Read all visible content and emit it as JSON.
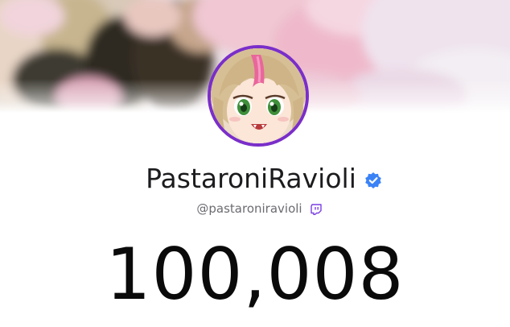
{
  "profile": {
    "display_name": "PastaroniRavioli",
    "handle": "@pastaroniravioli",
    "verified": true,
    "platform_icon": "twitch-icon"
  },
  "stats": {
    "follower_count": "100,008"
  },
  "colors": {
    "avatar_ring": "#7a2ec9",
    "verified_badge": "#3b82f6",
    "twitch_purple": "#7b3fe4",
    "text_primary": "#1c1c1f",
    "text_secondary": "#6b6b72"
  },
  "icons": {
    "verified": "verified-check-icon",
    "platform": "twitch-icon"
  }
}
